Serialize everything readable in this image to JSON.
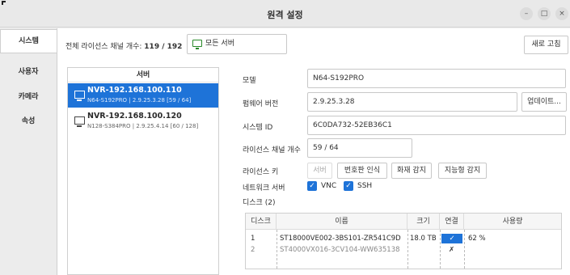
{
  "window": {
    "title": "원격 설정",
    "min": "–",
    "max": "□",
    "close": "×"
  },
  "sidebar": {
    "items": [
      {
        "label": "시스템",
        "active": true
      },
      {
        "label": "사용자",
        "active": false
      },
      {
        "label": "카메라",
        "active": false
      },
      {
        "label": "속성",
        "active": false
      }
    ]
  },
  "topbar": {
    "license_label": "전체 라이선스 채널 개수:",
    "license_value": "119 / 192",
    "all_servers": "모든 서버",
    "refresh": "새로 고침"
  },
  "server_list": {
    "header": "서버",
    "items": [
      {
        "name": "NVR-192.168.100.110",
        "sub": "N64-S192PRO | 2.9.25.3.28 [59 / 64]",
        "selected": true
      },
      {
        "name": "NVR-192.168.100.120",
        "sub": "N128-S384PRO | 2.9.25.4.14 [60 / 128]",
        "selected": false
      }
    ]
  },
  "details": {
    "model_label": "모델",
    "model_value": "N64-S192PRO",
    "firmware_label": "펌웨어 버전",
    "firmware_value": "2.9.25.3.28",
    "update_button": "업데이트...",
    "system_id_label": "시스템 ID",
    "system_id_value": "6C0DA732-52EB36C1",
    "license_ch_label": "라이선스 채널 개수",
    "license_ch_value": "59 / 64",
    "license_key_label": "라이선스 키",
    "license_keys": [
      "서버",
      "번호판 인식",
      "화재 감지",
      "지능형 감지"
    ],
    "network_server_label": "네트워크 서버",
    "vnc_label": "VNC",
    "ssh_label": "SSH",
    "disk_label": "디스크 (2)"
  },
  "disk_table": {
    "headers": [
      "디스크",
      "이름",
      "크기",
      "연결",
      "사용량"
    ],
    "rows": [
      {
        "index": "1",
        "name": "ST18000VE002-3BS101-ZR541C9D",
        "size": "18.0 TB",
        "connected": "✓",
        "usage": "62 %"
      },
      {
        "index": "2",
        "name": "ST4000VX016-3CV104-WW635138",
        "size": "",
        "connected": "✗",
        "usage": ""
      }
    ]
  },
  "colors": {
    "accent": "#1e73d8",
    "monitor_green": "#2a8a2a"
  }
}
